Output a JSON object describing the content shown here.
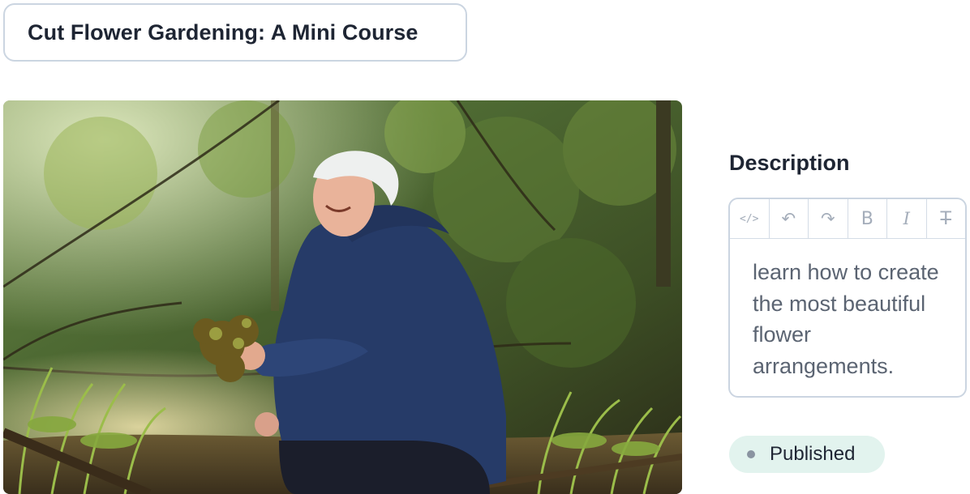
{
  "course": {
    "title": "Cut Flower Gardening: A Mini Course"
  },
  "hero_image": {
    "alt": "Smiling woman crouching in a sunlit forest holding moss among fern fiddleheads"
  },
  "description": {
    "label": "Description",
    "toolbar": {
      "code_label": "</>",
      "undo_label": "↶",
      "redo_label": "↷",
      "bold_label": "B",
      "italic_label": "I",
      "strike_label": "T"
    },
    "text": "learn how to create the most beautiful flower arrangements."
  },
  "status": {
    "label": "Published",
    "color": "#e2f3ee"
  }
}
